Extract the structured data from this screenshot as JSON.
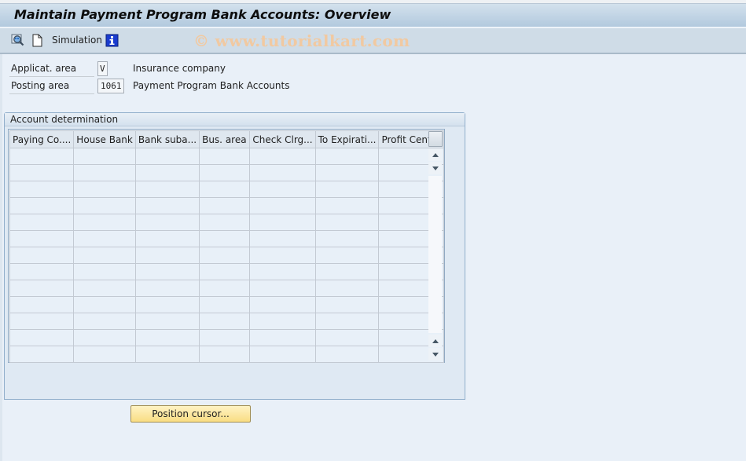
{
  "window": {
    "title": "Maintain Payment Program Bank Accounts: Overview"
  },
  "toolbar": {
    "items": [
      {
        "icon": "find-icon",
        "label": ""
      },
      {
        "icon": "new-document-icon",
        "label": ""
      },
      {
        "icon": "",
        "label": "Simulation"
      },
      {
        "icon": "information-icon",
        "label": ""
      }
    ],
    "simulation_label": "Simulation",
    "watermark": "© www.tutorialkart.com"
  },
  "fields": {
    "application_area": {
      "label": "Applicat. area",
      "value": "V",
      "description": "Insurance company"
    },
    "posting_area": {
      "label": "Posting area",
      "value": "1061",
      "description": "Payment Program Bank Accounts"
    }
  },
  "account_determination": {
    "title": "Account determination",
    "columns": [
      "Paying Co....",
      "House Bank",
      "Bank suba...",
      "Bus. area",
      "Check Clrg...",
      "To Expirati...",
      "Profit Center"
    ],
    "rows": [
      [
        "",
        "",
        "",
        "",
        "",
        "",
        ""
      ],
      [
        "",
        "",
        "",
        "",
        "",
        "",
        ""
      ],
      [
        "",
        "",
        "",
        "",
        "",
        "",
        ""
      ],
      [
        "",
        "",
        "",
        "",
        "",
        "",
        ""
      ],
      [
        "",
        "",
        "",
        "",
        "",
        "",
        ""
      ],
      [
        "",
        "",
        "",
        "",
        "",
        "",
        ""
      ],
      [
        "",
        "",
        "",
        "",
        "",
        "",
        ""
      ],
      [
        "",
        "",
        "",
        "",
        "",
        "",
        ""
      ],
      [
        "",
        "",
        "",
        "",
        "",
        "",
        ""
      ],
      [
        "",
        "",
        "",
        "",
        "",
        "",
        ""
      ],
      [
        "",
        "",
        "",
        "",
        "",
        "",
        ""
      ],
      [
        "",
        "",
        "",
        "",
        "",
        "",
        ""
      ],
      [
        "",
        "",
        "",
        "",
        "",
        "",
        ""
      ]
    ]
  },
  "buttons": {
    "position_cursor": "Position cursor..."
  },
  "colors": {
    "title_bar_top": "#d3e1ed",
    "title_bar_bottom": "#b2c9de",
    "background": "#e9f0f8",
    "button_yellow": "#f9dd83",
    "watermark": "#f1c9a1"
  }
}
